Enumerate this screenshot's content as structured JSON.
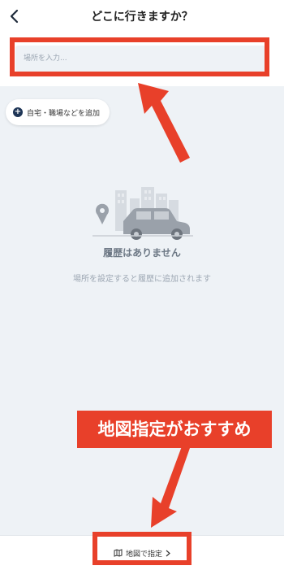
{
  "header": {
    "title": "どこに行きますか？",
    "back_icon": "chevron-left-icon"
  },
  "search": {
    "placeholder": "場所を入力..."
  },
  "add_place": {
    "label": "自宅・職場などを追加",
    "icon": "plus-circle-icon"
  },
  "empty_state": {
    "illustration": "city-car-pin-illustration",
    "title": "履歴はありません",
    "subtitle": "場所を設定すると履歴に追加されます"
  },
  "annotation": {
    "callout_text": "地図指定がおすすめ",
    "accent_color": "#e8402a"
  },
  "footer": {
    "map_button_label": "地図で指定",
    "map_icon": "map-icon",
    "chevron_icon": "chevron-right-icon"
  }
}
